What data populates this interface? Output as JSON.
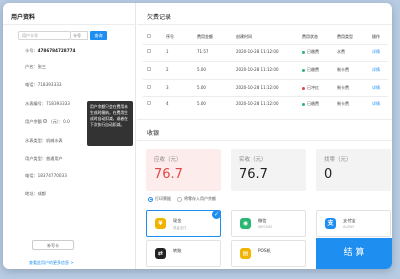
{
  "user": {
    "title": "用户资料",
    "search_placeholder": "用户卡号",
    "search_type": "卡号",
    "search_button": "查询",
    "card_label": "卡号：",
    "card_no": "4786784728774",
    "name_label": "户名：",
    "name": "张三",
    "phone_label": "电话：",
    "phone": "718393333",
    "meter_label": "水表编号：",
    "meter": "718393333",
    "balance_label": "用户余额",
    "balance": "（元）：0.0",
    "meter_type_label": "水表类型：",
    "meter_type": "机械水表",
    "user_type_label": "用户类型：",
    "user_type": "普通用户",
    "mobile_label": "电话：",
    "mobile": "18374770033",
    "address_label": "地址：",
    "address": "成都",
    "tooltip": "用户余额只会在费用未生成时缴纳，在费用生成时自动扣减，或者在下次执行自动扣减。",
    "add_button": "补写卡",
    "more_link": "查看此用户的更多信息 >"
  },
  "records": {
    "title": "欠费记录",
    "headers": [
      "序号",
      "费用金额",
      "创建时间",
      "费用状态",
      "费用类型",
      "操作"
    ],
    "rows": [
      {
        "no": "1",
        "amount": "71.57",
        "time": "2020-10-28 11:12:00",
        "status": "已缴费",
        "type": "水费",
        "action": "详情"
      },
      {
        "no": "2",
        "amount": "5.00",
        "time": "2020-10-28 11:12:00",
        "status": "已缴费",
        "type": "制卡费",
        "action": "详情"
      },
      {
        "no": "3",
        "amount": "5.00",
        "time": "2020-10-28 11:12:00",
        "status": "已冲红",
        "type": "制卡费",
        "action": "详情"
      },
      {
        "no": "4",
        "amount": "5.00",
        "time": "2020-10-28 11:12:00",
        "status": "已缴费",
        "type": "制卡费",
        "action": "详情"
      }
    ]
  },
  "payment": {
    "title": "收银",
    "due_label": "应收（元）",
    "due": "76.7",
    "paid_label": "实收（元）",
    "paid": "76.7",
    "change_label": "找零（元）",
    "change": "0",
    "option1": "打印票据",
    "option2": "将零存入用户余额",
    "methods": [
      {
        "name": "现金",
        "sub": "现金支付"
      },
      {
        "name": "微信",
        "sub": "WECHAT"
      },
      {
        "name": "支付宝",
        "sub": "ALIPAY"
      },
      {
        "name": "转账",
        "sub": ""
      },
      {
        "name": "POS机",
        "sub": ""
      }
    ],
    "settle": "结 算"
  }
}
